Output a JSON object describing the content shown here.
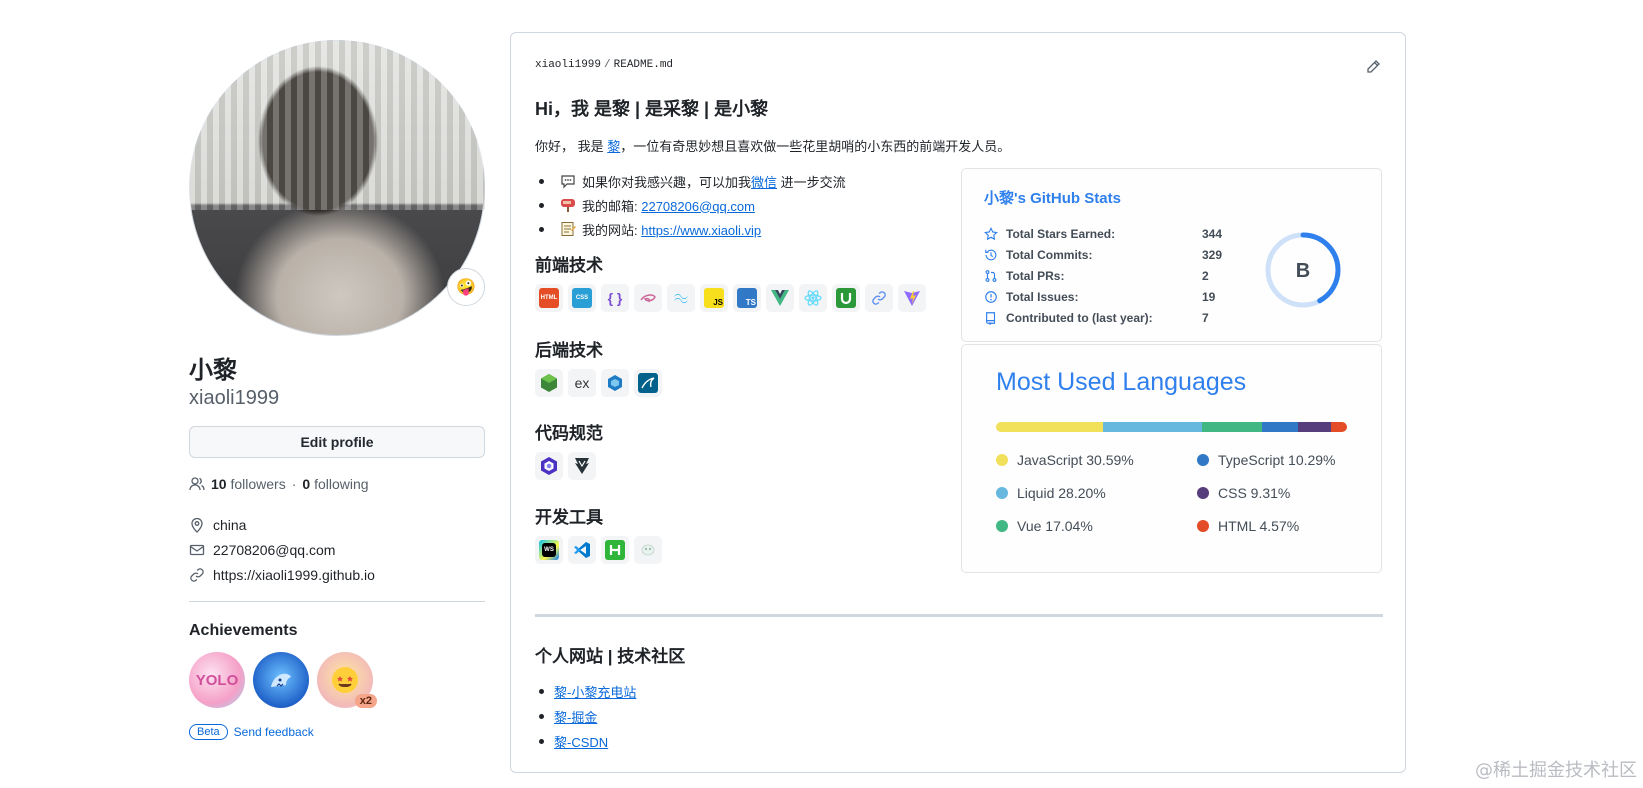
{
  "profile": {
    "name": "小黎",
    "login": "xiaoli1999",
    "status_emoji": "🤪",
    "edit_label": "Edit profile",
    "followers_count": "10",
    "followers_label": "followers",
    "separator": "·",
    "following_count": "0",
    "following_label": "following",
    "location": "china",
    "email": "22708206@qq.com",
    "website": "https://xiaoli1999.github.io",
    "achievements_title": "Achievements",
    "badge_yolo_text": "YOLO",
    "badge_multiplier": "x2",
    "beta_label": "Beta",
    "feedback_label": "Send feedback"
  },
  "readme": {
    "crumb_user": "xiaoli1999",
    "crumb_sep": "/",
    "crumb_file": "README.md",
    "title": "Hi，我 是黎 | 是采黎 | 是小黎",
    "intro_prefix": "你好， 我是 ",
    "intro_link": "黎",
    "intro_suffix": "，一位有奇思妙想且喜欢做一些花里胡哨的小东西的前端开发人员。",
    "contact_wechat_prefix": "如果你对我感兴趣，可以加我",
    "contact_wechat_link": "微信",
    "contact_wechat_suffix": " 进一步交流",
    "contact_email_label": "我的邮箱: ",
    "contact_email": "22708206@qq.com",
    "contact_site_label": "我的网站: ",
    "contact_site": "https://www.xiaoli.vip",
    "section_frontend": "前端技术",
    "section_backend": "后端技术",
    "section_lint": "代码规范",
    "section_tools": "开发工具",
    "section_community": "个人网站 | 技术社区",
    "community_links": [
      "黎-小黎充电站",
      "黎-掘金",
      "黎-CSDN"
    ],
    "icon_labels": {
      "html": "HTML",
      "css": "CSS",
      "js_obj": "{ }",
      "ts": "TS",
      "js": "JS",
      "ex": "ex",
      "ws": "WS"
    }
  },
  "stats": {
    "title_name": "小黎",
    "title_rest": "'s GitHub Stats",
    "rows": [
      {
        "label": "Total Stars Earned:",
        "value": "344"
      },
      {
        "label": "Total Commits:",
        "value": "329"
      },
      {
        "label": "Total PRs:",
        "value": "2"
      },
      {
        "label": "Total Issues:",
        "value": "19"
      },
      {
        "label": "Contributed to (last year):",
        "value": "7"
      }
    ],
    "grade": "B",
    "grade_progress": 0.42,
    "accent": "#2f80ed"
  },
  "languages": {
    "title": "Most Used Languages",
    "items": [
      {
        "name": "JavaScript",
        "percent": "30.59%",
        "value": 30.59,
        "color": "#f1e05a"
      },
      {
        "name": "Liquid",
        "percent": "28.20%",
        "value": 28.2,
        "color": "#67b8de"
      },
      {
        "name": "Vue",
        "percent": "17.04%",
        "value": 17.04,
        "color": "#41b883"
      },
      {
        "name": "TypeScript",
        "percent": "10.29%",
        "value": 10.29,
        "color": "#3178c6"
      },
      {
        "name": "CSS",
        "percent": "9.31%",
        "value": 9.31,
        "color": "#563d7c"
      },
      {
        "name": "HTML",
        "percent": "4.57%",
        "value": 4.57,
        "color": "#e34c26"
      }
    ]
  },
  "watermark": "@稀土掘金技术社区"
}
